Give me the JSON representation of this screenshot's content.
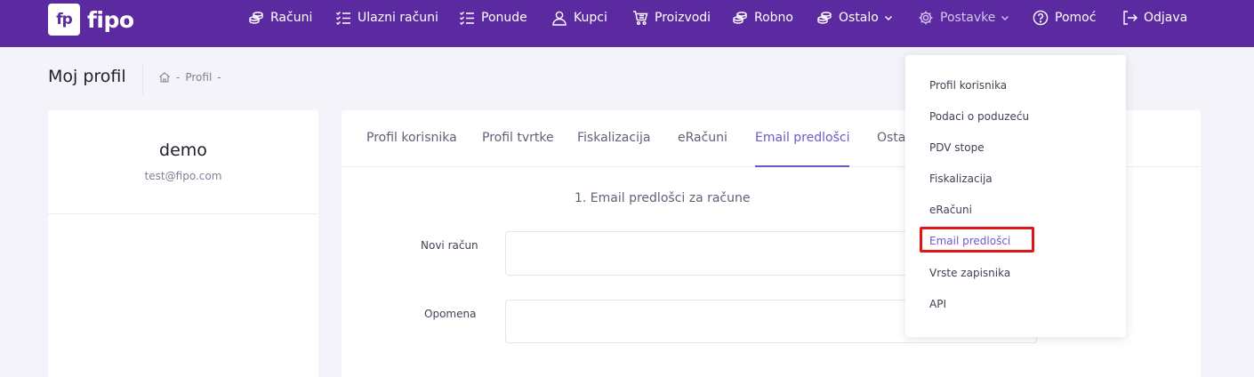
{
  "brand": {
    "logo_mark": "fp",
    "name": "fipo"
  },
  "nav": {
    "items": [
      {
        "label": "Računi",
        "icon": "coins-icon"
      },
      {
        "label": "Ulazni računi",
        "icon": "list-check-icon"
      },
      {
        "label": "Ponude",
        "icon": "list-check-icon"
      },
      {
        "label": "Kupci",
        "icon": "user-icon"
      },
      {
        "label": "Proizvodi",
        "icon": "cart-icon"
      },
      {
        "label": "Robno",
        "icon": "coins-icon"
      },
      {
        "label": "Ostalo",
        "icon": "coins-icon"
      },
      {
        "label": "Postavke",
        "icon": "gear-icon"
      },
      {
        "label": "Pomoć",
        "icon": "help-circle-icon"
      },
      {
        "label": "Odjava",
        "icon": "logout-icon"
      }
    ]
  },
  "page": {
    "title": "Moj profil",
    "breadcrumb": [
      "-",
      "Profil",
      "-"
    ]
  },
  "profile": {
    "name": "demo",
    "email": "test@fipo.com"
  },
  "tabs": [
    {
      "label": "Profil korisnika"
    },
    {
      "label": "Profil tvrtke"
    },
    {
      "label": "Fiskalizacija"
    },
    {
      "label": "eRačuni"
    },
    {
      "label": "Email predlošci",
      "active": true
    },
    {
      "label": "Osta"
    }
  ],
  "form": {
    "section_title": "1. Email predlošci za račune",
    "fields": [
      {
        "label": "Novi račun",
        "value": ""
      },
      {
        "label": "Opomena",
        "value": ""
      }
    ]
  },
  "dropdown": {
    "items": [
      {
        "label": "Profil korisnika"
      },
      {
        "label": "Podaci o poduzeću"
      },
      {
        "label": "PDV stope"
      },
      {
        "label": "Fiskalizacija"
      },
      {
        "label": "eRačuni"
      },
      {
        "label": "Email predlošci",
        "selected": true
      },
      {
        "label": "Vrste zapisnika"
      },
      {
        "label": "API"
      }
    ]
  },
  "colors": {
    "navbar": "#5b2aa0",
    "accent": "#6f58c9",
    "highlight": "#e01616",
    "background": "#f3f3f9"
  }
}
